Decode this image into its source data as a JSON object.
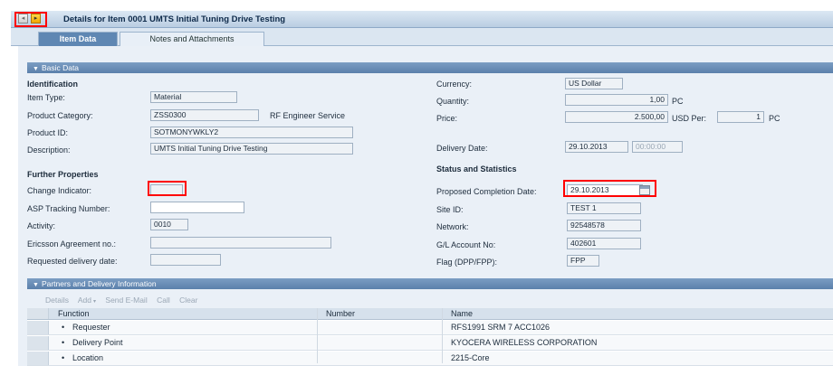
{
  "window": {
    "title": "Details for Item 0001 UMTS Initial Tuning Drive Testing",
    "nav_prev": "◂",
    "nav_next": "▸"
  },
  "tabs": [
    {
      "label": "Item Data",
      "active": true
    },
    {
      "label": "Notes and Attachments",
      "active": false
    }
  ],
  "basic_data": {
    "header": "Basic Data",
    "identification": {
      "title": "Identification",
      "item_type_label": "Item Type:",
      "item_type": "Material",
      "product_category_label": "Product Category:",
      "product_category": "ZSS0300",
      "product_category_desc": "RF Engineer Service",
      "product_id_label": "Product ID:",
      "product_id": "SOTMONYWKLY2",
      "description_label": "Description:",
      "description": "UMTS Initial Tuning Drive Testing"
    },
    "further_properties": {
      "title": "Further Properties",
      "change_indicator_label": "Change Indicator:",
      "change_indicator": "",
      "asp_tracking_label": "ASP Tracking Number:",
      "asp_tracking": "",
      "activity_label": "Activity:",
      "activity": "0010",
      "ericsson_agreement_label": "Ericsson Agreement no.:",
      "ericsson_agreement": "",
      "requested_delivery_label": "Requested delivery date:",
      "requested_delivery": ""
    },
    "commercial": {
      "currency_label": "Currency:",
      "currency": "US Dollar",
      "quantity_label": "Quantity:",
      "quantity": "1,00",
      "quantity_unit": "PC",
      "price_label": "Price:",
      "price": "2.500,00",
      "price_currency_per": "USD Per:",
      "price_per": "1",
      "price_per_unit": "PC",
      "delivery_date_label": "Delivery Date:",
      "delivery_date": "29.10.2013",
      "delivery_time": "00:00:00"
    },
    "status": {
      "title": "Status and Statistics",
      "proposed_completion_label": "Proposed Completion Date:",
      "proposed_completion": "29.10.2013",
      "site_id_label": "Site ID:",
      "site_id": "TEST 1",
      "network_label": "Network:",
      "network": "92548578",
      "gl_account_label": "G/L Account No:",
      "gl_account": "402601",
      "flag_label": "Flag (DPP/FPP):",
      "flag": "FPP"
    }
  },
  "partners": {
    "header": "Partners and Delivery Information",
    "toolbar": [
      "Details",
      "Add",
      "Send E-Mail",
      "Call",
      "Clear"
    ],
    "columns": [
      "Function",
      "Number",
      "Name"
    ],
    "rows": [
      {
        "function": "Requester",
        "number": "",
        "name": "RFS1991 SRM 7 ACC1026"
      },
      {
        "function": "Delivery Point",
        "number": "",
        "name": "KYOCERA WIRELESS CORPORATION"
      },
      {
        "function": "Location",
        "number": "",
        "name": "2215-Core"
      }
    ]
  },
  "colors": {
    "highlight": "#ff0000",
    "section_header": "#5b80ab",
    "active_tab": "#5f87b3"
  }
}
